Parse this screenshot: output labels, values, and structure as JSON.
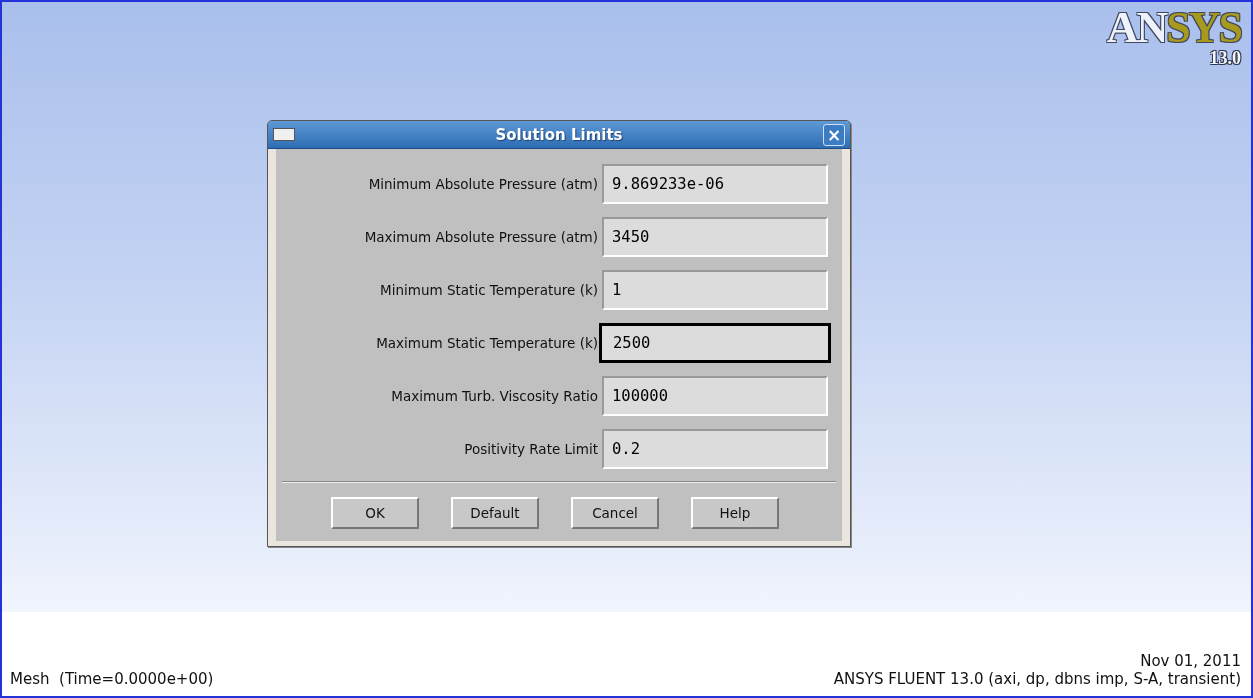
{
  "logo": {
    "parts": [
      {
        "text": "AN",
        "color": "#eef2fa"
      },
      {
        "text": "SYS",
        "color": "#a89a1c"
      }
    ],
    "version": "13.0"
  },
  "dialog": {
    "title": "Solution Limits",
    "close": "×",
    "fields": [
      {
        "label": "Minimum Absolute Pressure (atm)",
        "value": "9.869233e-06",
        "focused": false
      },
      {
        "label": "Maximum Absolute Pressure (atm)",
        "value": "3450",
        "focused": false
      },
      {
        "label": "Minimum Static Temperature (k)",
        "value": "1",
        "focused": false
      },
      {
        "label": "Maximum Static Temperature (k)",
        "value": "2500",
        "focused": true
      },
      {
        "label": "Maximum Turb. Viscosity Ratio",
        "value": "100000",
        "focused": false
      },
      {
        "label": "Positivity Rate Limit",
        "value": "0.2",
        "focused": false
      }
    ],
    "buttons": [
      "OK",
      "Default",
      "Cancel",
      "Help"
    ]
  },
  "status": {
    "left": "Mesh  (Time=0.0000e+00)",
    "date": "Nov 01, 2011",
    "version": "ANSYS FLUENT 13.0 (axi, dp, dbns imp, S-A, transient)"
  }
}
